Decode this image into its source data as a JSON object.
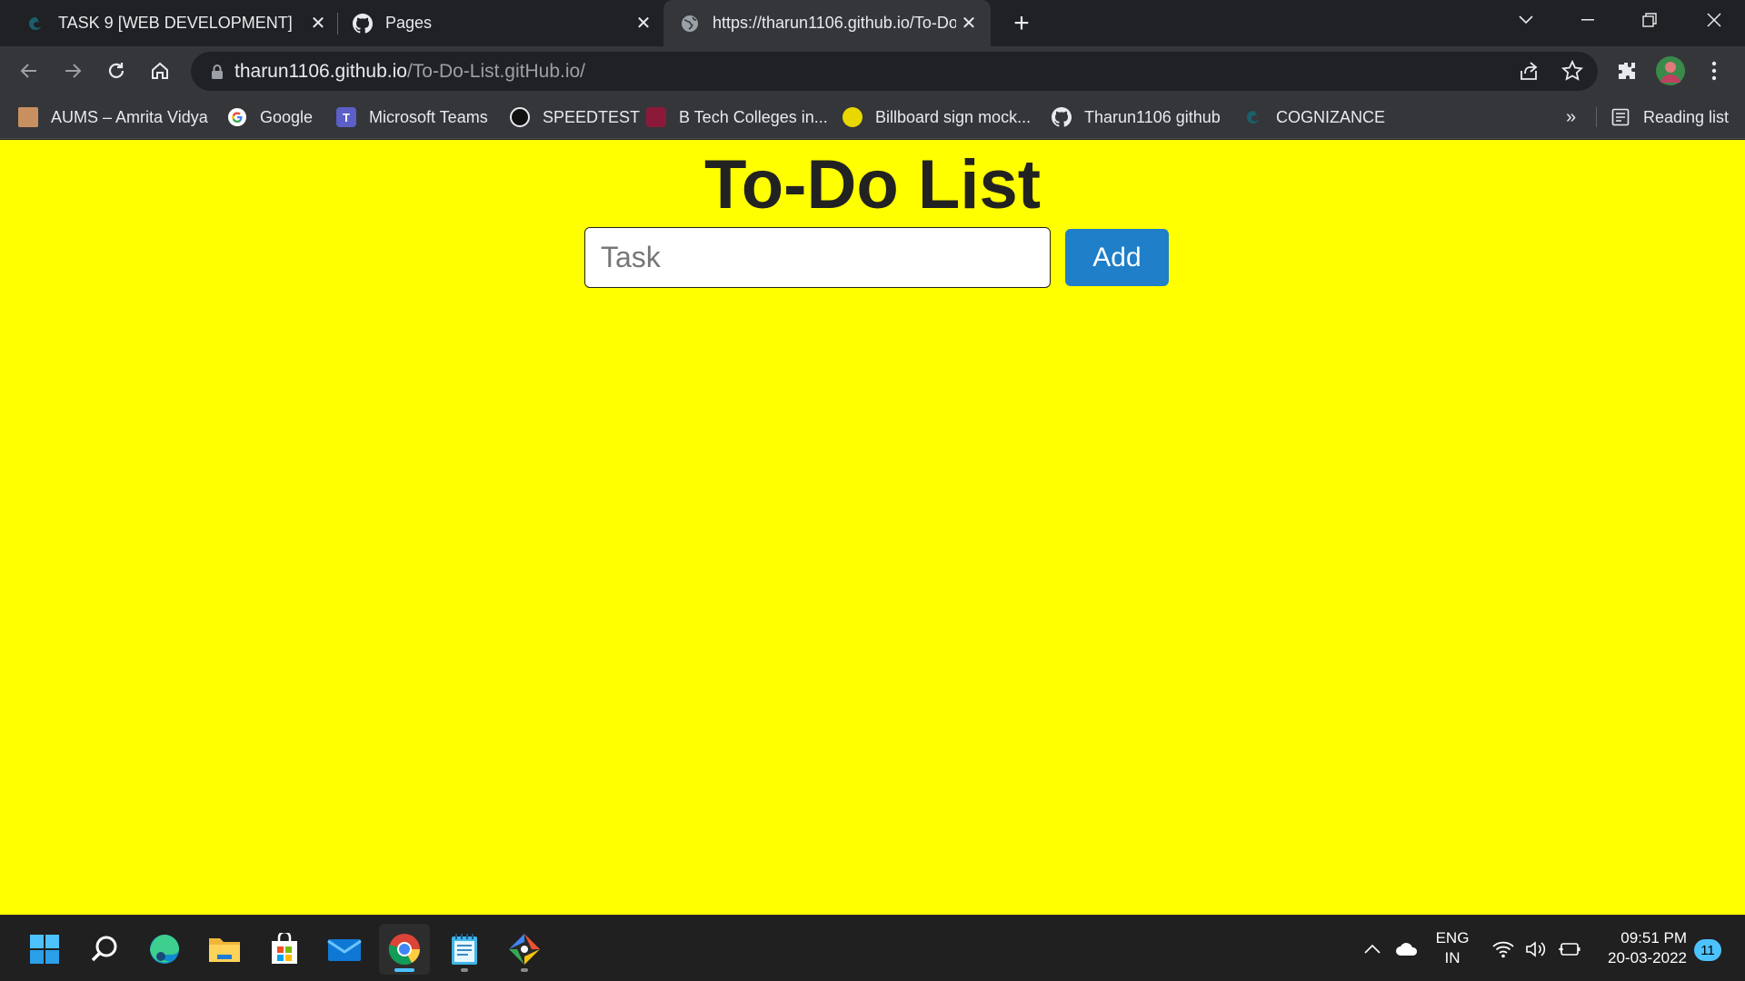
{
  "browser": {
    "tabs": [
      {
        "title": "TASK 9 [WEB DEVELOPMENT]",
        "icon": "edge-dev-icon"
      },
      {
        "title": "Pages",
        "icon": "github-icon"
      },
      {
        "title": "https://tharun1106.github.io/To-Do-List.gitHub.io/",
        "icon": "globe-icon",
        "active": true
      }
    ],
    "address": {
      "host": "tharun1106.github.io",
      "path": "/To-Do-List.gitHub.io/"
    },
    "bookmarks": [
      {
        "label": "AUMS – Amrita Vidya",
        "icon": "aums-icon"
      },
      {
        "label": "Google",
        "icon": "google-icon"
      },
      {
        "label": "Microsoft Teams",
        "icon": "teams-icon"
      },
      {
        "label": "SPEEDTEST",
        "icon": "speedtest-icon"
      },
      {
        "label": "B Tech Colleges in...",
        "icon": "college-icon"
      },
      {
        "label": "Billboard sign mock...",
        "icon": "billboard-icon"
      },
      {
        "label": "Tharun1106 github",
        "icon": "github-icon"
      },
      {
        "label": "COGNIZANCE",
        "icon": "cognizance-icon"
      }
    ],
    "more_bookmarks": "»",
    "reading_list": "Reading list"
  },
  "page": {
    "title": "To-Do List",
    "task_placeholder": "Task",
    "task_value": "",
    "add_label": "Add",
    "background": "#ffff00",
    "button_color": "#1f7fc8"
  },
  "taskbar": {
    "lang_line1": "ENG",
    "lang_line2": "IN",
    "time": "09:51 PM",
    "date": "20-03-2022",
    "notifications": "11"
  }
}
